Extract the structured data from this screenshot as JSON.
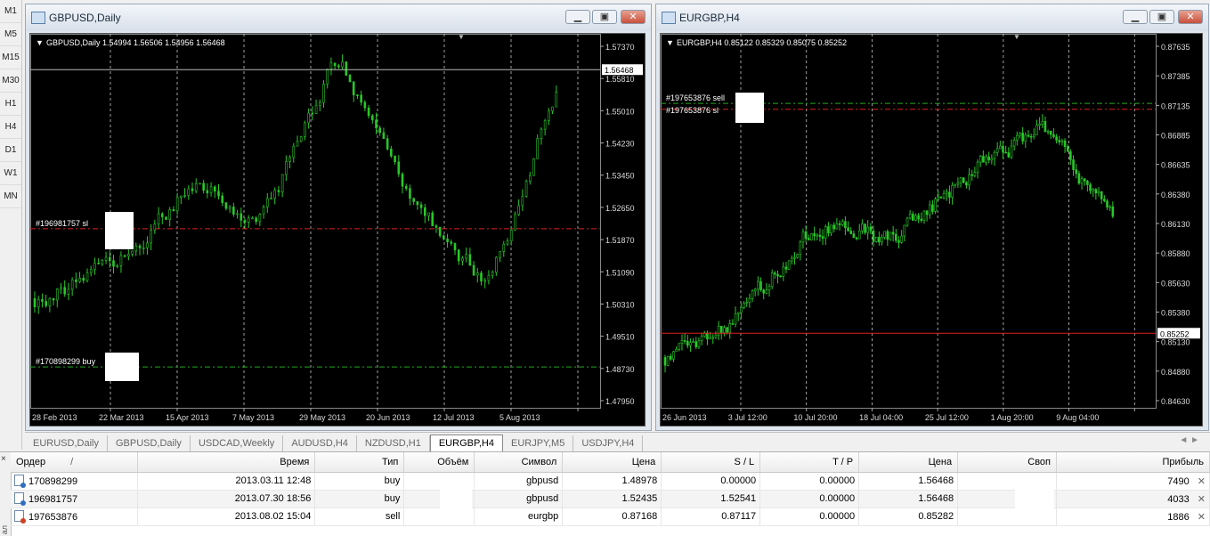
{
  "timeframes": [
    "M1",
    "M5",
    "M15",
    "M30",
    "H1",
    "H4",
    "D1",
    "W1",
    "MN"
  ],
  "windows": [
    {
      "title": "GBPUSD,Daily",
      "header": "GBPUSD,Daily  1.54994 1.56506 1.54956 1.56468",
      "price_labels": [
        "1.57370",
        "1.55810",
        "1.55010",
        "1.54230",
        "1.53450",
        "1.52650",
        "1.51870",
        "1.51090",
        "1.50310",
        "1.49510",
        "1.48730",
        "1.47950"
      ],
      "current_price": "1.56468",
      "date_labels": [
        "28 Feb 2013",
        "22 Mar 2013",
        "15 Apr 2013",
        "7 May 2013",
        "29 May 2013",
        "20 Jun 2013",
        "12 Jul 2013",
        "5 Aug 2013"
      ],
      "order_labels": [
        "#196981757 sl",
        "#170898299 buy"
      ]
    },
    {
      "title": "EURGBP,H4",
      "header": "EURGBP,H4  0.85122 0.85329 0.85075 0.85252",
      "price_labels": [
        "0.87635",
        "0.87385",
        "0.87135",
        "0.86885",
        "0.86635",
        "0.86380",
        "0.86130",
        "0.85880",
        "0.85630",
        "0.85380",
        "0.85130",
        "0.84880",
        "0.84630"
      ],
      "current_price": "0.85252",
      "date_labels": [
        "26 Jun 2013",
        "3 Jul 12:00",
        "10 Jul 20:00",
        "18 Jul 04:00",
        "25 Jul 12:00",
        "1 Aug 20:00",
        "9 Aug 04:00"
      ],
      "order_labels": [
        "#197653876 sell",
        "#197653876 sl"
      ]
    }
  ],
  "chart_data": [
    {
      "type": "candlestick",
      "symbol": "GBPUSD",
      "timeframe": "Daily",
      "x": [
        "28 Feb 2013",
        "22 Mar 2013",
        "15 Apr 2013",
        "7 May 2013",
        "29 May 2013",
        "20 Jun 2013",
        "12 Jul 2013",
        "5 Aug 2013"
      ],
      "y_approx_close": [
        1.507,
        1.517,
        1.536,
        1.527,
        1.569,
        1.53,
        1.51,
        1.565
      ],
      "ylim": [
        1.4795,
        1.5737
      ],
      "levels": {
        "sl_196981757": 1.5246,
        "buy_170898299": 1.4898,
        "current": 1.56468
      },
      "colors": {
        "candles": "#28c828",
        "grid": "#c8c8c8",
        "sl_line": "#e02020",
        "entry_line": "#22aa22",
        "background": "#000000"
      }
    },
    {
      "type": "candlestick",
      "symbol": "EURGBP",
      "timeframe": "H4",
      "x": [
        "26 Jun 2013",
        "3 Jul 12:00",
        "10 Jul 20:00",
        "18 Jul 04:00",
        "25 Jul 12:00",
        "1 Aug 20:00",
        "9 Aug 04:00"
      ],
      "y_approx_close": [
        0.8505,
        0.8545,
        0.862,
        0.86,
        0.866,
        0.87,
        0.8615
      ],
      "ylim": [
        0.8463,
        0.8775
      ],
      "levels": {
        "sell_197653876": 0.8717,
        "sl_197653876": 0.8712,
        "current": 0.85252
      },
      "colors": {
        "candles": "#28c828",
        "grid": "#c8c8c8",
        "sl_line": "#e02020",
        "entry_line": "#22aa22",
        "background": "#000000"
      }
    }
  ],
  "tabs": [
    "EURUSD,Daily",
    "GBPUSD,Daily",
    "USDCAD,Weekly",
    "AUDUSD,H4",
    "NZDUSD,H1",
    "EURGBP,H4",
    "EURJPY,M5",
    "USDJPY,H4"
  ],
  "active_tab": "EURGBP,H4",
  "tab_arrows": "◄ ►",
  "terminal": {
    "close_glyph": "×",
    "side_label": "ал",
    "columns": [
      "Ордер",
      "Время",
      "Тип",
      "Объём",
      "Символ",
      "Цена",
      "S / L",
      "T / P",
      "Цена",
      "Своп",
      "Прибыль"
    ],
    "sort_mark": "/",
    "rows": [
      {
        "order": "170898299",
        "time": "2013.03.11 12:48",
        "type": "buy",
        "volume": "",
        "symbol": "gbpusd",
        "price": "1.48978",
        "sl": "0.00000",
        "tp": "0.00000",
        "cur_price": "1.56468",
        "swap": "",
        "profit": "7490"
      },
      {
        "order": "196981757",
        "time": "2013.07.30 18:56",
        "type": "buy",
        "volume": "",
        "symbol": "gbpusd",
        "price": "1.52435",
        "sl": "1.52541",
        "tp": "0.00000",
        "cur_price": "1.56468",
        "swap": "",
        "profit": "4033"
      },
      {
        "order": "197653876",
        "time": "2013.08.02 15:04",
        "type": "sell",
        "volume": "",
        "symbol": "eurgbp",
        "price": "0.87168",
        "sl": "0.87117",
        "tp": "0.00000",
        "cur_price": "0.85282",
        "swap": "",
        "profit": "1886"
      }
    ]
  }
}
